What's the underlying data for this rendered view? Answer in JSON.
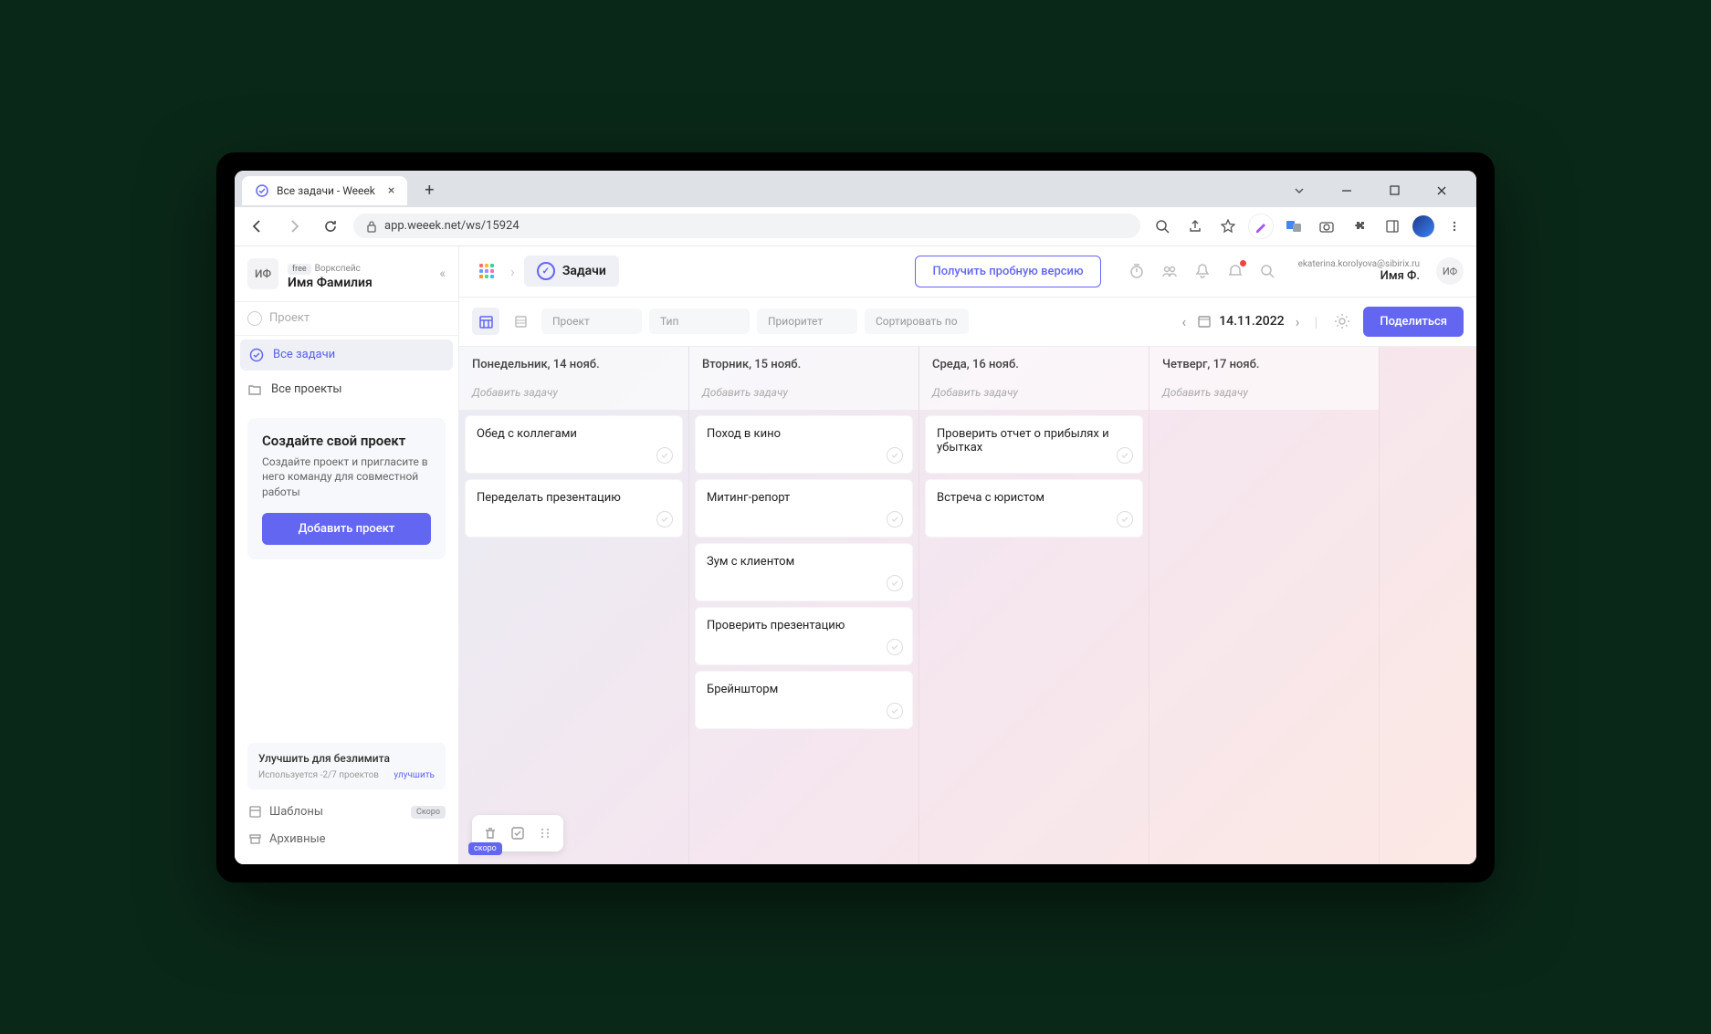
{
  "browser": {
    "tab_title": "Все задачи - Weeek",
    "url": "app.weeek.net/ws/15924"
  },
  "workspace": {
    "avatar_initials": "ИФ",
    "badge": "free",
    "label": "Воркспейс",
    "name": "Имя Фамилия"
  },
  "sidebar": {
    "project_placeholder": "Проект",
    "all_tasks": "Все задачи",
    "all_projects": "Все проекты",
    "create": {
      "title": "Создайте свой проект",
      "desc": "Создайте проект и пригласите в него команду для совместной работы",
      "button": "Добавить проект"
    },
    "upgrade": {
      "title": "Улучшить для безлимита",
      "usage": "Используется -2/7 проектов",
      "link": "улучшить"
    },
    "templates": "Шаблоны",
    "templates_badge": "Скоро",
    "archived": "Архивные"
  },
  "topbar": {
    "tasks_label": "Задачи",
    "trial_button": "Получить пробную версию",
    "user_email": "ekaterina.korolyova@sibirix.ru",
    "user_name": "Имя Ф.",
    "user_initials": "ИФ"
  },
  "filters": {
    "project": "Проект",
    "type": "Тип",
    "priority": "Приоритет",
    "sort": "Сортировать по",
    "date": "14.11.2022",
    "share": "Поделиться"
  },
  "board": {
    "add_task_label": "Добавить задачу",
    "columns": [
      {
        "header": "Понедельник, 14 нояб.",
        "cards": [
          "Обед с коллегами",
          "Переделать презентацию"
        ]
      },
      {
        "header": "Вторник, 15 нояб.",
        "cards": [
          "Поход в кино",
          "Митинг-репорт",
          "Зум с клиентом",
          "Проверить презентацию",
          "Брейншторм"
        ]
      },
      {
        "header": "Среда, 16 нояб.",
        "cards": [
          "Проверить отчет о прибылях и убытках",
          "Встреча с юристом"
        ]
      },
      {
        "header": "Четверг, 17 нояб.",
        "cards": []
      }
    ],
    "widget_soon": "скоро"
  }
}
